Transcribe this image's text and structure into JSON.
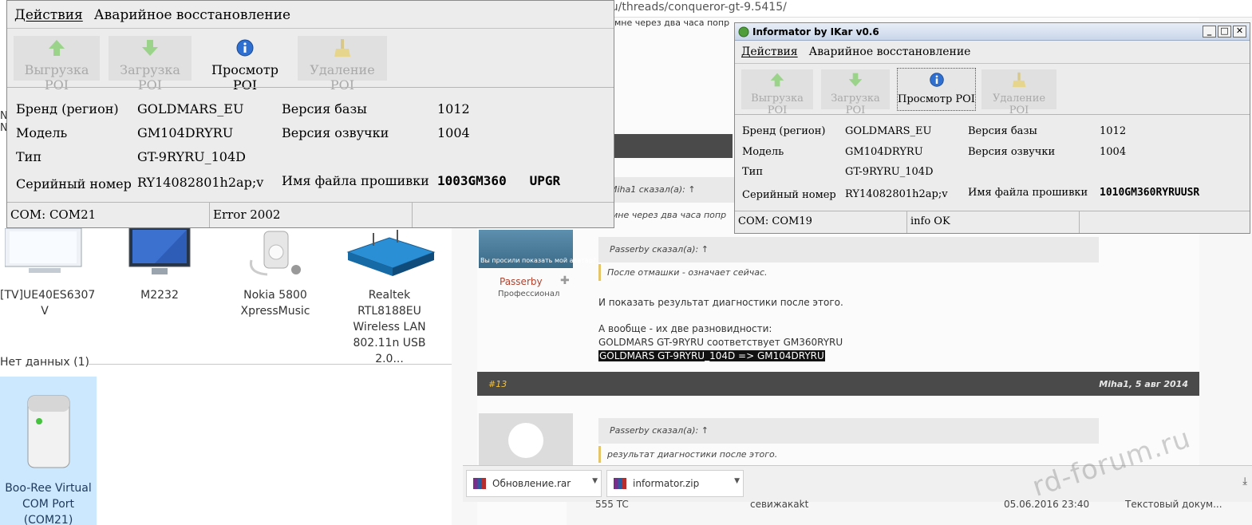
{
  "browser": {
    "url": "ru/threads/conqueror-gt-9.5415/",
    "snippet_top": "мне через два часа попр",
    "quote_header_1": "Miha1 сказал(а): ↑",
    "quote_body_1": "мне через два часа попр",
    "avatar_caption": "Вы просили показать мой аватар?",
    "user_name": "Passerby",
    "user_rank": "Профессионал",
    "quote_header_2": "Passerby сказал(а): ↑",
    "quote_body_2": "После отмашки - означает сейчас.",
    "text_line_1": "И показать результат диагностики после этого.",
    "text_line_2": "А вообще - их две разновидности:",
    "text_line_3": "GOLDMARS GT-9RYRU соответствует GM360RYRU",
    "text_line_4": "GOLDMARS GT-9RYRU_104D => GM104DRYRU",
    "post_number": "#13",
    "post_meta": "Miha1, 5 авг 2014",
    "quote_header_3": "Passerby сказал(а): ↑",
    "quote_body_3": "результат диагностики после этого.",
    "downloads": [
      "Обновление.rar",
      "informator.zip"
    ],
    "bottom_row_1": "555 TC",
    "bottom_row_2": "ceвижакаkt",
    "bottom_row_3": "05.06.2016 23:40",
    "bottom_row_4": "Текстовый докум...",
    "watermark": "rd-forum.ru"
  },
  "desktop": {
    "devices": [
      {
        "label": "[TV]UE40ES6307 V"
      },
      {
        "label": "M2232"
      },
      {
        "label": "Nokia 5800 XpressMusic"
      },
      {
        "label": "Realtek RTL8188EU Wireless LAN 802.11n USB 2.0..."
      }
    ],
    "group_label": "Нет данных (1)",
    "boo_device": "Boo-Ree Virtual COM Port (COM21)",
    "left_clip_1": "C",
    "left_clip_2": "N",
    "left_clip_3": "N"
  },
  "left_window": {
    "menu": [
      "Действия",
      "Аварийное восстановление"
    ],
    "toolbar": [
      {
        "label": "Выгрузка POI",
        "icon": "arrow-up-icon",
        "state": "disabled"
      },
      {
        "label": "Загрузка POI",
        "icon": "arrow-down-icon",
        "state": "disabled"
      },
      {
        "label": "Просмотр POI",
        "icon": "info-icon",
        "state": "enabled"
      },
      {
        "label": "Удаление POI",
        "icon": "broom-icon",
        "state": "disabled"
      }
    ],
    "info": {
      "brand_label": "Бренд (регион)",
      "brand_value": "GOLDMARS_EU",
      "model_label": "Модель",
      "model_value": "GM104DRYRU",
      "type_label": "Тип",
      "type_value": "GT-9RYRU_104D",
      "serial_label": "Серийный номер",
      "serial_value": "RY14082801h2ap;v",
      "db_label": "Версия базы",
      "db_value": "1012",
      "voice_label": "Версия озвучки",
      "voice_value": "1004",
      "fw_label": "Имя файла прошивки",
      "fw_value": "1003GM360   UPGR"
    },
    "status": [
      "COM: COM21",
      "Error 2002",
      ""
    ]
  },
  "right_window": {
    "title": "Informator by IKar v0.6",
    "menu": [
      "Действия",
      "Аварийное восстановление"
    ],
    "toolbar": [
      {
        "label": "Выгрузка POI",
        "icon": "arrow-up-icon",
        "state": "disabled"
      },
      {
        "label": "Загрузка POI",
        "icon": "arrow-down-icon",
        "state": "disabled"
      },
      {
        "label": "Просмотр POI",
        "icon": "info-icon",
        "state": "active"
      },
      {
        "label": "Удаление POI",
        "icon": "broom-icon",
        "state": "disabled"
      }
    ],
    "info": {
      "brand_label": "Бренд (регион)",
      "brand_value": "GOLDMARS_EU",
      "model_label": "Модель",
      "model_value": "GM104DRYRU",
      "type_label": "Тип",
      "type_value": "GT-9RYRU_104D",
      "serial_label": "Серийный номер",
      "serial_value": "RY14082801h2ap;v",
      "db_label": "Версия базы",
      "db_value": "1012",
      "voice_label": "Версия озвучки",
      "voice_value": "1004",
      "fw_label": "Имя файла прошивки",
      "fw_value": "1010GM360RYRUUSR"
    },
    "status": [
      "COM: COM19",
      "info OK",
      ""
    ]
  },
  "colors": {
    "accent_green": "#5cb85c",
    "info_blue": "#2f6fcf",
    "window_bg": "#ececec"
  }
}
